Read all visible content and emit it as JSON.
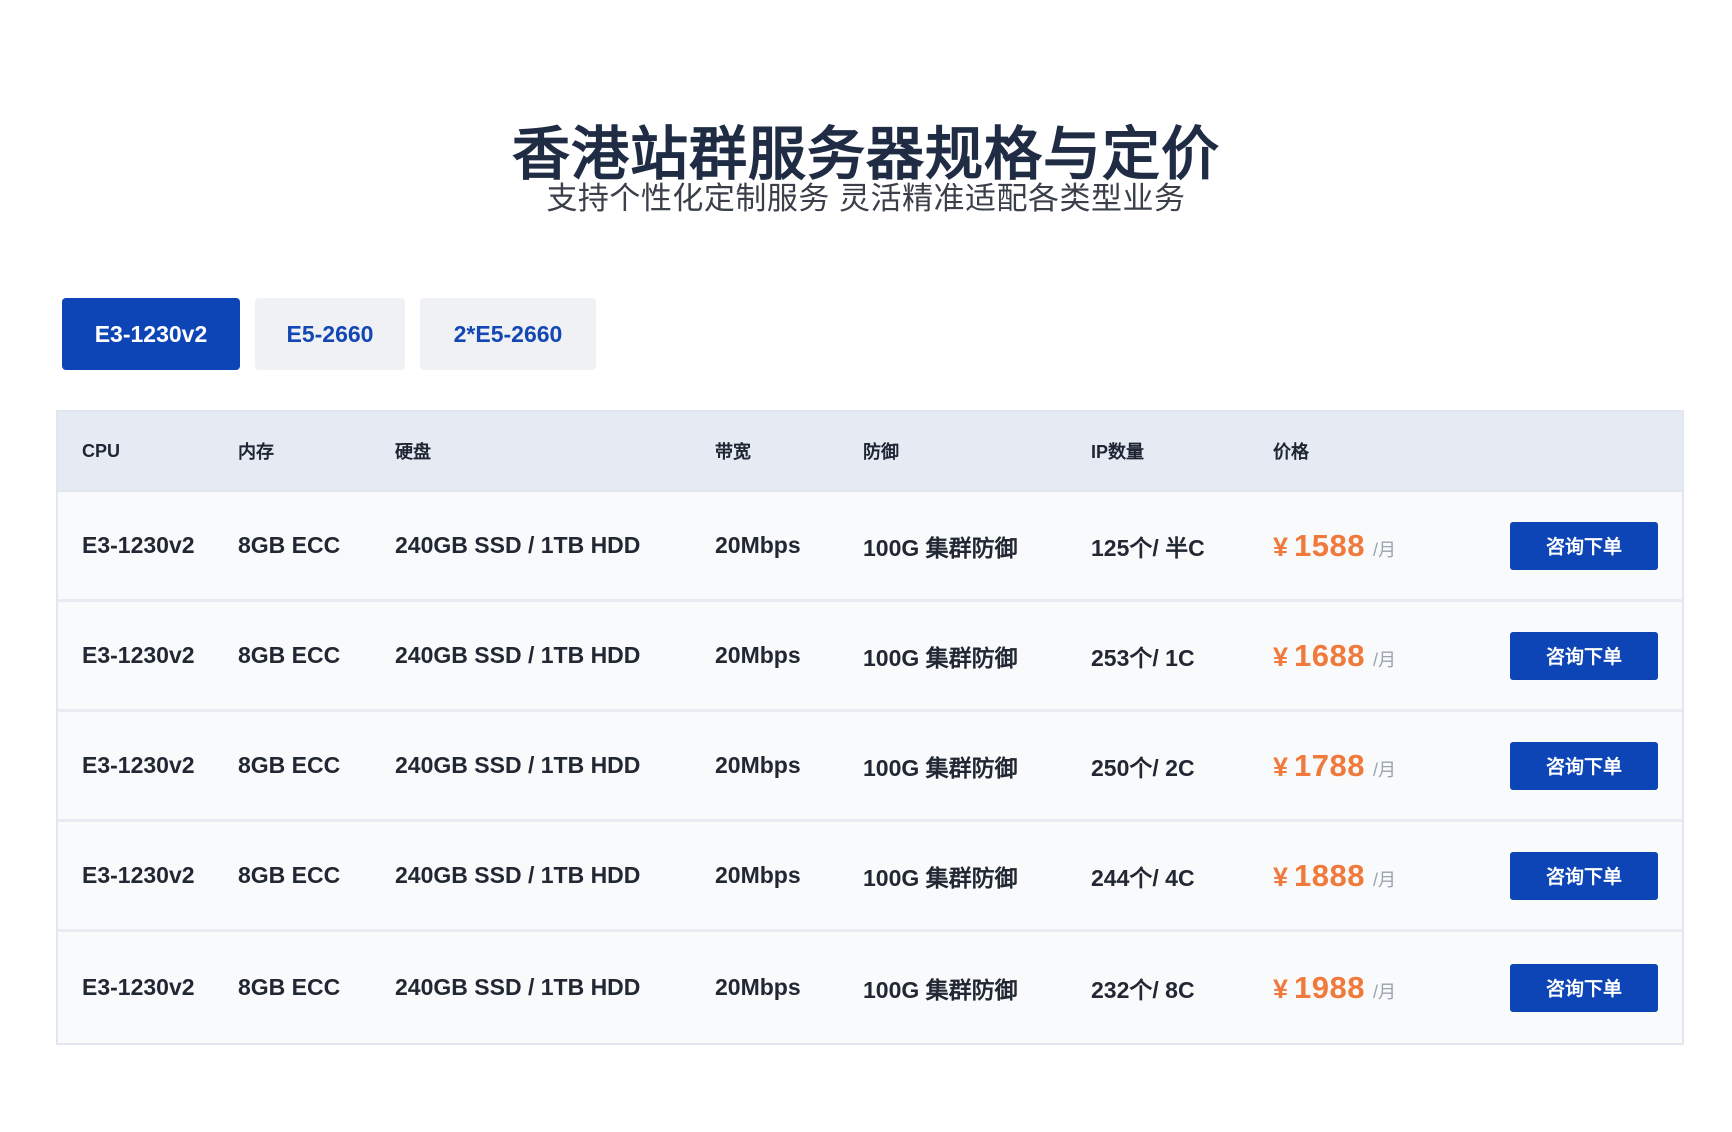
{
  "header": {
    "title": "香港站群服务器规格与定价",
    "subtitle": "支持个性化定制服务 灵活精准适配各类型业务"
  },
  "tabs": [
    {
      "label": "E3-1230v2",
      "active": true
    },
    {
      "label": "E5-2660",
      "active": false
    },
    {
      "label": "2*E5-2660",
      "active": false
    }
  ],
  "table": {
    "columns": [
      "CPU",
      "内存",
      "硬盘",
      "带宽",
      "防御",
      "IP数量",
      "价格"
    ],
    "rows": [
      {
        "cpu": "E3-1230v2",
        "memory": "8GB ECC",
        "disk": "240GB SSD / 1TB HDD",
        "bandwidth": "20Mbps",
        "ddos": "100G 集群防御",
        "ip": "125个/ 半C",
        "currency": "¥",
        "price": "1588",
        "unit": "/月",
        "action": "咨询下单"
      },
      {
        "cpu": "E3-1230v2",
        "memory": "8GB ECC",
        "disk": "240GB SSD / 1TB HDD",
        "bandwidth": "20Mbps",
        "ddos": "100G 集群防御",
        "ip": "253个/ 1C",
        "currency": "¥",
        "price": "1688",
        "unit": "/月",
        "action": "咨询下单"
      },
      {
        "cpu": "E3-1230v2",
        "memory": "8GB ECC",
        "disk": "240GB SSD / 1TB HDD",
        "bandwidth": "20Mbps",
        "ddos": "100G 集群防御",
        "ip": "250个/ 2C",
        "currency": "¥",
        "price": "1788",
        "unit": "/月",
        "action": "咨询下单"
      },
      {
        "cpu": "E3-1230v2",
        "memory": "8GB ECC",
        "disk": "240GB SSD / 1TB HDD",
        "bandwidth": "20Mbps",
        "ddos": "100G 集群防御",
        "ip": "244个/ 4C",
        "currency": "¥",
        "price": "1888",
        "unit": "/月",
        "action": "咨询下单"
      },
      {
        "cpu": "E3-1230v2",
        "memory": "8GB ECC",
        "disk": "240GB SSD / 1TB HDD",
        "bandwidth": "20Mbps",
        "ddos": "100G 集群防御",
        "ip": "232个/ 8C",
        "currency": "¥",
        "price": "1988",
        "unit": "/月",
        "action": "咨询下单"
      }
    ]
  },
  "colors": {
    "primary": "#0d45b6",
    "price": "#ef7a3c",
    "header_bg": "#e6eaf3"
  }
}
